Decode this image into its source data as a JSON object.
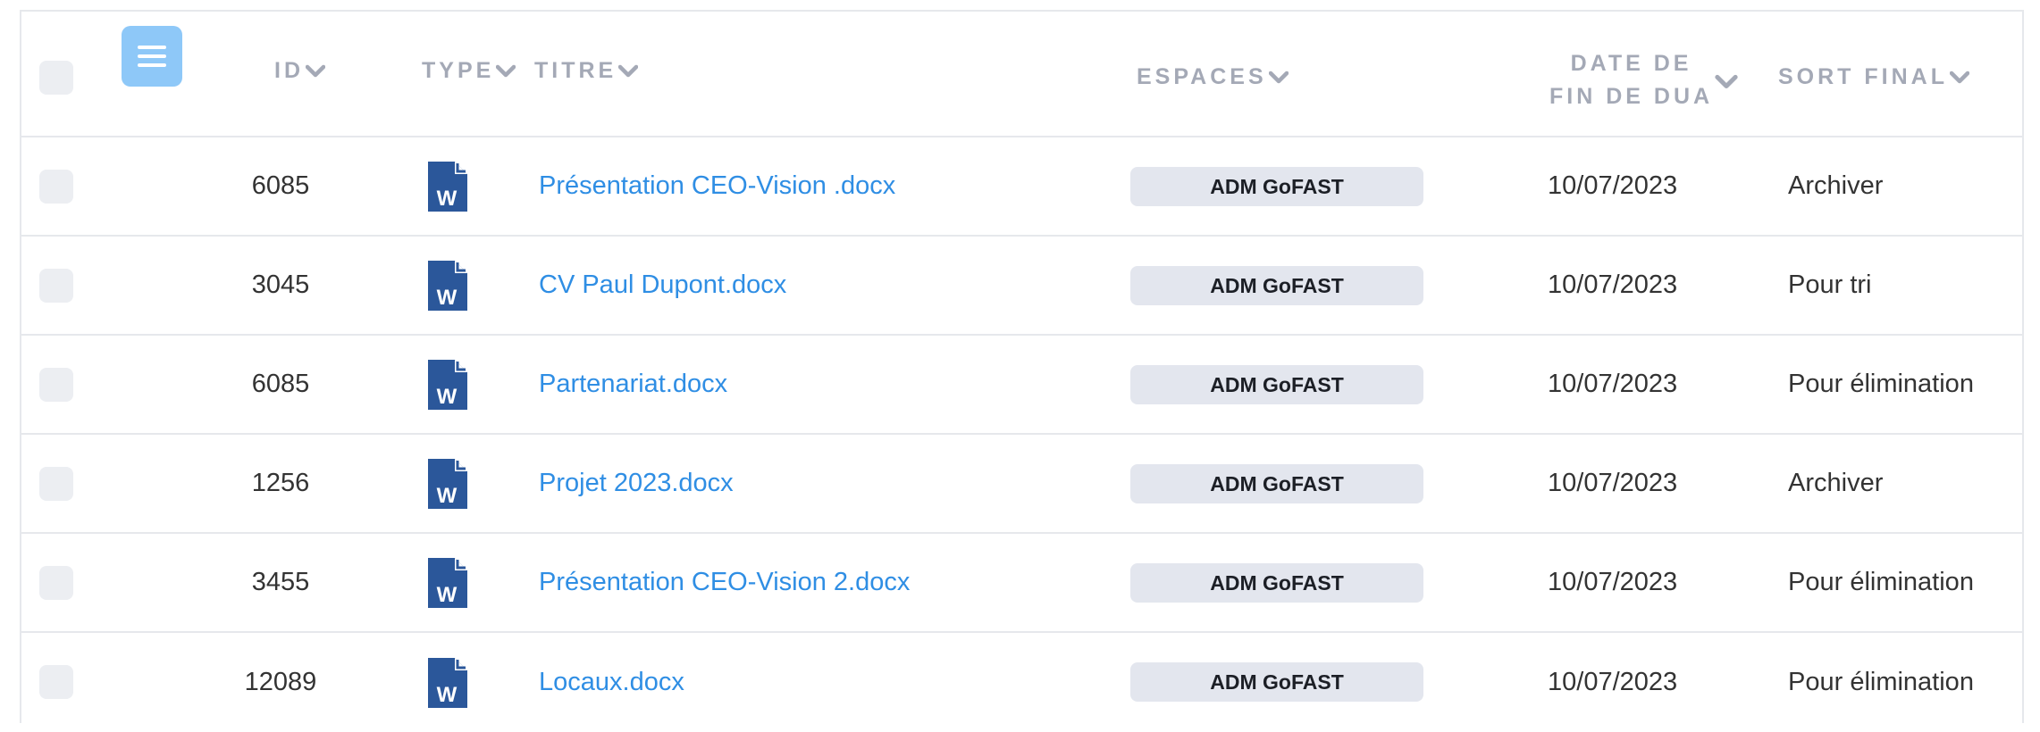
{
  "header": {
    "columns": {
      "id": "ID",
      "type": "TYPE",
      "titre": "TITRE",
      "espaces": "ESPACES",
      "date_line1": "DATE DE",
      "date_line2": "FIN DE DUA",
      "sort_final": "SORT FINAL"
    },
    "menu_icon": "hamburger-menu-icon",
    "sort_icon": "chevron-down-icon"
  },
  "colors": {
    "link": "#2f8ee4",
    "header_text": "#a4a9b6",
    "badge_bg": "#e3e6ee",
    "menu_button": "#8ec8f8",
    "word_blue": "#2b579a"
  },
  "rows": [
    {
      "id": "6085",
      "type_icon": "word-document-icon",
      "type_letter": "W",
      "titre": "Présentation CEO-Vision .docx",
      "espace": "ADM GoFAST",
      "date": "10/07/2023",
      "sort": "Archiver"
    },
    {
      "id": "3045",
      "type_icon": "word-document-icon",
      "type_letter": "W",
      "titre": "CV Paul Dupont.docx",
      "espace": "ADM GoFAST",
      "date": "10/07/2023",
      "sort": "Pour tri"
    },
    {
      "id": "6085",
      "type_icon": "word-document-icon",
      "type_letter": "W",
      "titre": "Partenariat.docx",
      "espace": "ADM GoFAST",
      "date": "10/07/2023",
      "sort": "Pour élimination"
    },
    {
      "id": "1256",
      "type_icon": "word-document-icon",
      "type_letter": "W",
      "titre": "Projet 2023.docx",
      "espace": "ADM GoFAST",
      "date": "10/07/2023",
      "sort": "Archiver"
    },
    {
      "id": "3455",
      "type_icon": "word-document-icon",
      "type_letter": "W",
      "titre": "Présentation CEO-Vision 2.docx",
      "espace": "ADM GoFAST",
      "date": "10/07/2023",
      "sort": "Pour élimination"
    },
    {
      "id": "12089",
      "type_icon": "word-document-icon",
      "type_letter": "W",
      "titre": "Locaux.docx",
      "espace": "ADM GoFAST",
      "date": "10/07/2023",
      "sort": "Pour élimination"
    }
  ]
}
